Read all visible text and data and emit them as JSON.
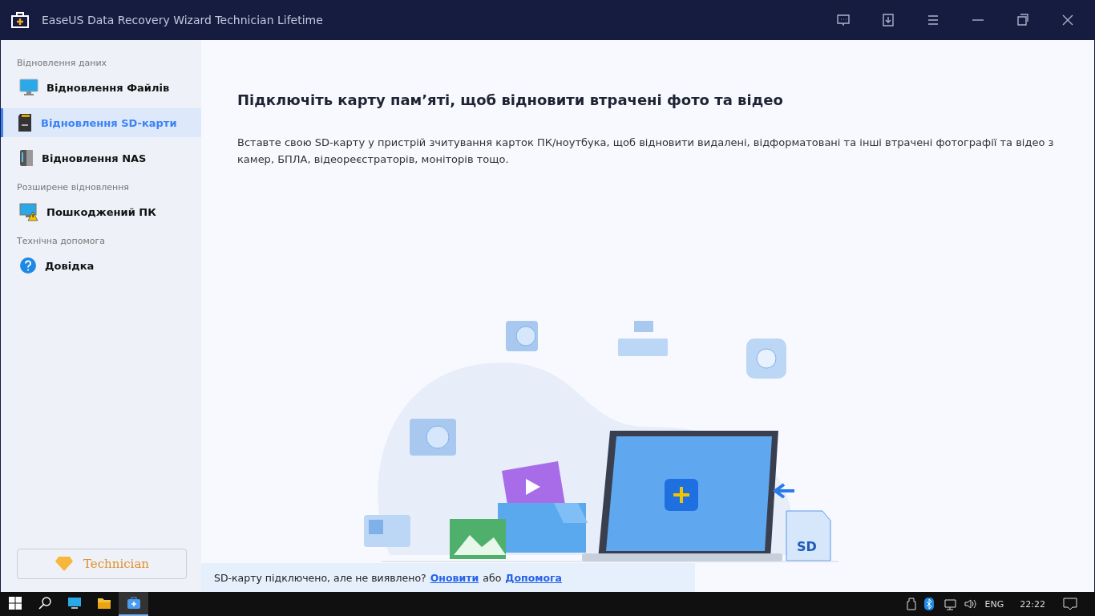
{
  "window": {
    "title": "EaseUS Data Recovery Wizard Technician Lifetime"
  },
  "sidebar": {
    "sections": [
      {
        "heading": "Відновлення даних",
        "items": [
          {
            "label": "Відновлення Файлів",
            "kind": "monitor",
            "selected": false
          },
          {
            "label": "Відновлення SD-карти",
            "kind": "sd",
            "selected": true
          },
          {
            "label": "Відновлення NAS",
            "kind": "nas",
            "selected": false
          }
        ]
      },
      {
        "heading": "Розширене відновлення",
        "items": [
          {
            "label": "Пошкоджений ПК",
            "kind": "pc-warning",
            "selected": false
          }
        ]
      },
      {
        "heading": "Технічна допомога",
        "items": [
          {
            "label": "Довідка",
            "kind": "help",
            "selected": false
          }
        ]
      }
    ],
    "upgrade_button": "Technician"
  },
  "main": {
    "heading": "Підключіть карту пам’яті, щоб відновити втрачені фото та відео",
    "description": "Вставте свою SD-карту у пристрій зчитування карток ПК/ноутбука, щоб відновити видалені, відформатовані та інші втрачені фотографії та відео з камер, БПЛА, відеореєстраторів, моніторів тощо.",
    "illustration_card_label": "SD",
    "notice": {
      "text": "SD-карту підключено, але не виявлено?",
      "link_refresh": "Оновити",
      "connector": "або",
      "link_help": "Допомога"
    }
  },
  "taskbar": {
    "apps": [
      {
        "kind": "start",
        "selected": false
      },
      {
        "kind": "search",
        "selected": false
      },
      {
        "kind": "desktop",
        "selected": false
      },
      {
        "kind": "explorer",
        "selected": false
      },
      {
        "kind": "app",
        "selected": true
      }
    ],
    "language": "ENG",
    "time": "22:22"
  }
}
